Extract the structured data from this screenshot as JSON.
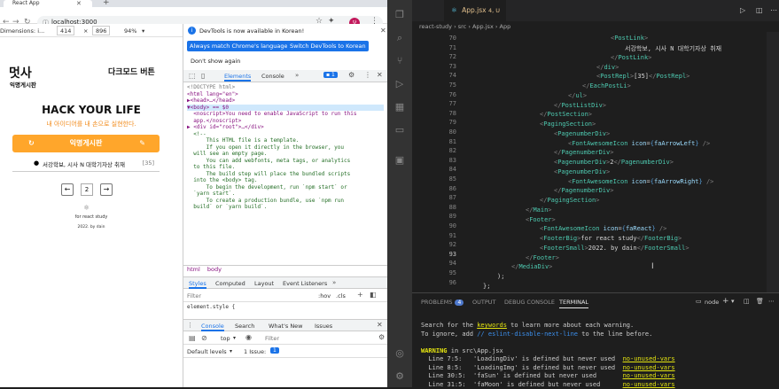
{
  "browser": {
    "tab_title": "React App",
    "url": "localhost:3000",
    "device_bar": {
      "dimensions_label": "Dimensions: i...",
      "width": "414",
      "height": "896",
      "zoom": "94%"
    }
  },
  "app": {
    "logo": "멋사",
    "logo_sub": "익명게시판",
    "darkmode_label": "다크모드 버튼",
    "hero_title": "HACK YOUR LIFE",
    "hero_sub": "내 아이디어를 내 손으로 실현한다.",
    "write_button": "익명게시판",
    "post_text": "서강학보, 시사 N 대학기자상 취재",
    "post_count": "[35]",
    "page_number": "2",
    "footer_big": "for react study",
    "footer_small": "2022. by dain"
  },
  "devtools": {
    "notice": "DevTools is now available in Korean!",
    "btn_match": "Always match Chrome's language",
    "btn_switch": "Switch DevTools to Korean",
    "dont_show": "Don't show again",
    "tabs": [
      "Elements",
      "Console"
    ],
    "issue_count": "1",
    "code_lines": [
      "<!DOCTYPE html>",
      "<html lang=\"en\">",
      "▶<head>…</head>",
      "▼<body> == $0",
      "  <noscript>You need to enable JavaScript to run this",
      "  app.</noscript>",
      "▶ <div id=\"root\">…</div>",
      "  <!--",
      "      This HTML file is a template.",
      "      If you open it directly in the browser, you",
      "  will see an empty page.",
      "",
      "      You can add webfonts, meta tags, or analytics",
      "  to this file.",
      "      The build step will place the bundled scripts",
      "  into the <body> tag.",
      "",
      "      To begin the development, run `npm start` or",
      "  `yarn start`.",
      "      To create a production bundle, use `npm run",
      "  build` or `yarn build`."
    ],
    "crumbs": [
      "html",
      "body"
    ],
    "style_tabs": [
      "Styles",
      "Computed",
      "Layout",
      "Event Listeners"
    ],
    "filter_placeholder": "Filter",
    "hov": ":hov",
    "cls": ".cls",
    "element_style": "element.style {",
    "console_tabs": [
      "Console",
      "Search",
      "What's New",
      "Issues"
    ],
    "top_context": "top",
    "console_filter": "Filter",
    "default_levels": "Default levels",
    "issue_label": "1 Issue:",
    "issue_num": "1"
  },
  "vscode": {
    "tab_label": "App.jsx",
    "tab_modified": "4, U",
    "breadcrumb": [
      "react-study",
      "src",
      "App.jsx",
      "App"
    ],
    "line_numbers": [
      "70",
      "71",
      "72",
      "73",
      "74",
      "75",
      "76",
      "77",
      "78",
      "79",
      "80",
      "81",
      "82",
      "83",
      "84",
      "85",
      "86",
      "87",
      "88",
      "89",
      "90",
      "91",
      "92",
      "93",
      "94",
      "95",
      "96"
    ],
    "panel_tabs": [
      "PROBLEMS",
      "OUTPUT",
      "DEBUG CONSOLE",
      "TERMINAL"
    ],
    "problems_count": "4",
    "terminal_shell": "node",
    "terminal": {
      "l1a": "Search for the ",
      "l1b": "keywords",
      "l1c": " to learn more about each warning.",
      "l2a": "To ignore, add ",
      "l2b": "// eslint-disable-next-line",
      "l2c": " to the line before.",
      "warn": "WARNING",
      "warn_rest": " in src\\App.jsx",
      "w1": "  Line 7:5:   'LoadingDiv' is defined but never used  ",
      "w2": "  Line 8:5:   'LoadingImg' is defined but never used  ",
      "w3": "  Line 30:5:  'faSun' is defined but never used       ",
      "w4": "  Line 31:5:  'faMoon' is defined but never used      ",
      "rule": "no-unused-vars"
    }
  }
}
